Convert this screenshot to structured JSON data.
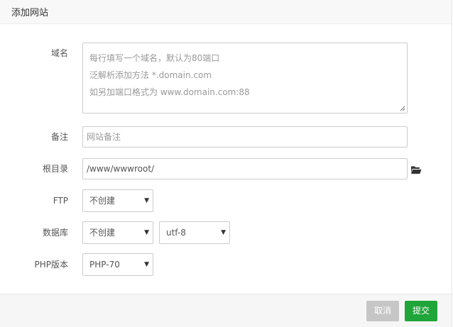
{
  "dialog": {
    "title": "添加网站"
  },
  "form": {
    "domain": {
      "label": "域名",
      "placeholder_lines": [
        "每行填写一个域名，默认为80端口",
        "泛解析添加方法 *.domain.com",
        "如另加端口格式为 www.domain.com:88"
      ]
    },
    "remark": {
      "label": "备注",
      "placeholder": "网站备注"
    },
    "root": {
      "label": "根目录",
      "value": "/www/wwwroot/"
    },
    "ftp": {
      "label": "FTP",
      "selected": "不创建"
    },
    "database": {
      "label": "数据库",
      "selected": "不创建",
      "charset": "utf-8"
    },
    "php": {
      "label": "PHP版本",
      "selected": "PHP-70"
    }
  },
  "footer": {
    "cancel_label": "取消",
    "submit_label": "提交"
  },
  "icons": {
    "folder": "folder-open-icon",
    "caret": "caret-down-icon"
  },
  "colors": {
    "submit": "#20a53a",
    "cancel": "#c6c6c6"
  }
}
